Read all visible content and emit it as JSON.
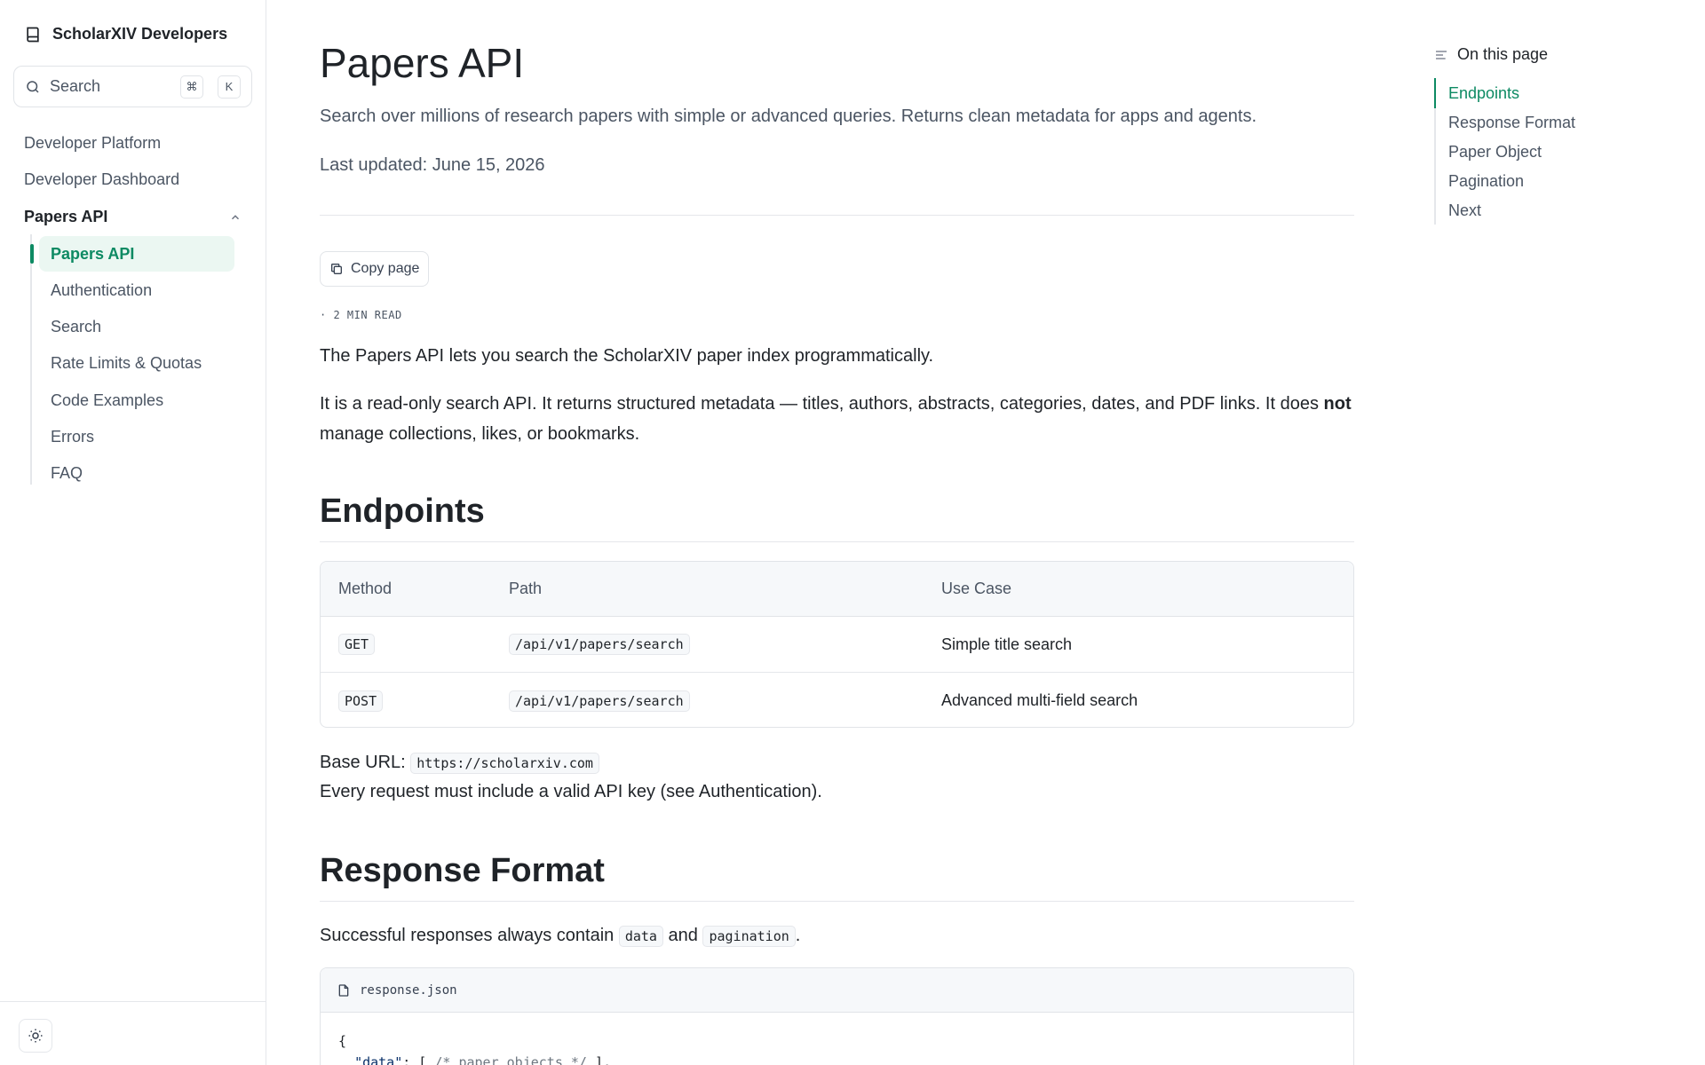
{
  "brand": {
    "name": "ScholarXIV Developers",
    "icon": "book-icon"
  },
  "search": {
    "label": "Search",
    "kbd_mod": "⌘",
    "kbd_key": "K"
  },
  "sidebar": {
    "top_items": [
      "Developer Platform",
      "Developer Dashboard"
    ],
    "group": {
      "label": "Papers API",
      "expanded": true
    },
    "sub_items": [
      "Papers API",
      "Authentication",
      "Search",
      "Rate Limits & Quotas",
      "Code Examples",
      "Errors",
      "FAQ"
    ],
    "active_sub": "Papers API"
  },
  "page": {
    "title": "Papers API",
    "subtitle": "Search over millions of research papers with simple or advanced queries. Returns clean metadata for apps and agents.",
    "updated": "Last updated: June 15, 2026",
    "copy_button": "Copy page",
    "read_time": "· 2 MIN READ",
    "intro1": "The Papers API lets you search the ScholarXIV paper index programmatically.",
    "intro2_pre": "It is a read-only search API. It returns structured metadata — titles, authors, abstracts, categories, dates, and PDF links. It does ",
    "intro2_bold": "not",
    "intro2_post": " manage collections, likes, or bookmarks."
  },
  "endpoints": {
    "heading": "Endpoints",
    "columns": [
      "Method",
      "Path",
      "Use Case"
    ],
    "rows": [
      {
        "method": "GET",
        "path": "/api/v1/papers/search",
        "use": "Simple title search"
      },
      {
        "method": "POST",
        "path": "/api/v1/papers/search",
        "use": "Advanced multi-field search"
      }
    ],
    "base_url_label": "Base URL:",
    "base_url": "https://scholarxiv.com",
    "auth_note": "Every request must include a valid API key (see Authentication)."
  },
  "response_format": {
    "heading": "Response Format",
    "text_pre": "Successful responses always contain ",
    "code1": "data",
    "text_mid": " and ",
    "code2": "pagination",
    "text_post": ".",
    "file_name": "response.json",
    "code_line1": "{",
    "code_key": "\"data\"",
    "code_rest1": ": [ ",
    "code_comment": "/* paper objects */",
    "code_rest2": " ],"
  },
  "toc": {
    "heading": "On this page",
    "items": [
      "Endpoints",
      "Response Format",
      "Paper Object",
      "Pagination",
      "Next"
    ],
    "active": "Endpoints"
  },
  "colors": {
    "accent": "#0d8a63",
    "active_bg": "#ebf7f2"
  }
}
